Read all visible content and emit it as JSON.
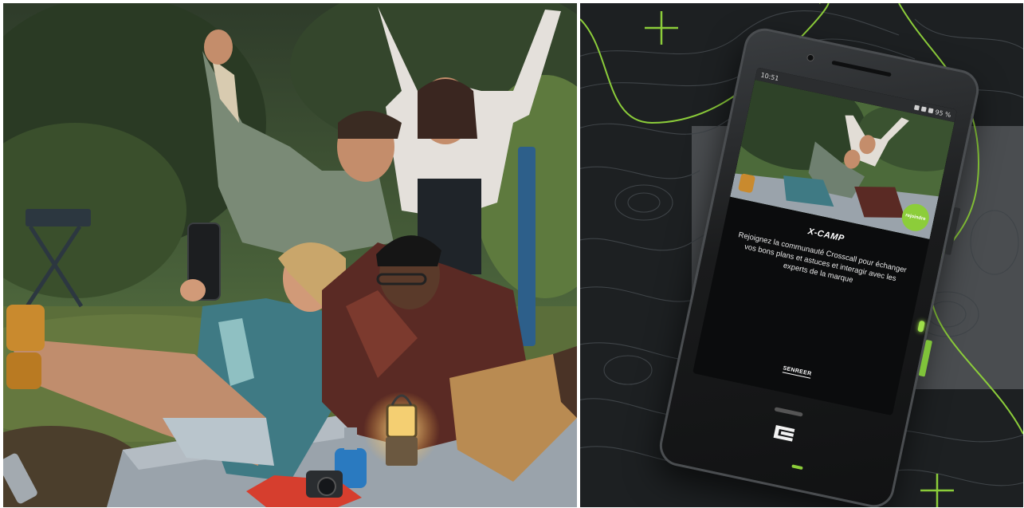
{
  "screen": {
    "status_time": "10:51",
    "status_battery": "95 %",
    "badge": "rejoindre",
    "title": "X-CAMP",
    "description": "Rejoignez la communauté Crosscall pour échanger vos bons plans et astuces et interagir avec les experts de la marque",
    "cta": "SENREER"
  },
  "colors": {
    "accent": "#8ccd3a",
    "panel_bg": "#1d2022",
    "contour_lines": "#4a4f53",
    "grey_band": "#4a4d50"
  },
  "icons": {
    "plus_top": "plus-icon",
    "plus_bottom": "plus-icon",
    "brand_logo": "crosscall-logo-icon"
  }
}
